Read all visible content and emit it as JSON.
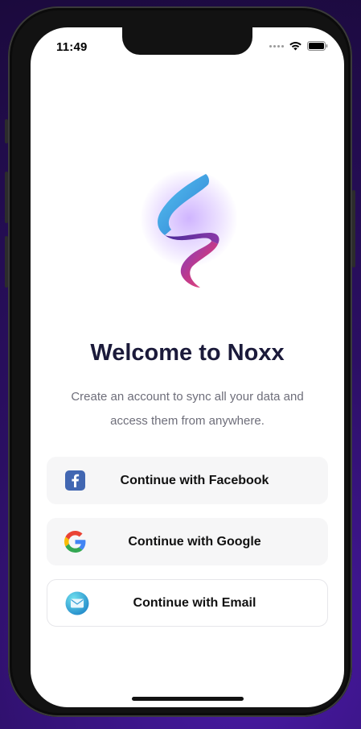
{
  "status_bar": {
    "time": "11:49",
    "icons": [
      "signal-dots-icon",
      "wifi-icon",
      "battery-icon"
    ]
  },
  "logo": {
    "icon": "noxx-logo-icon",
    "colors": {
      "blue": "#3aa0e6",
      "purple": "#5b2fb0",
      "pink": "#e0437a"
    }
  },
  "welcome": {
    "title": "Welcome to Noxx",
    "subtitle": "Create an account to sync all your data and access them from anywhere."
  },
  "buttons": [
    {
      "label": "Continue with Facebook",
      "icon": "facebook-icon"
    },
    {
      "label": "Continue with Google",
      "icon": "google-icon"
    },
    {
      "label": "Continue with Email",
      "icon": "email-icon"
    }
  ],
  "colors": {
    "title": "#1b1a3a",
    "subtitle": "#6e6e7a",
    "button_bg": "#f6f6f7",
    "facebook": "#4267b2"
  }
}
